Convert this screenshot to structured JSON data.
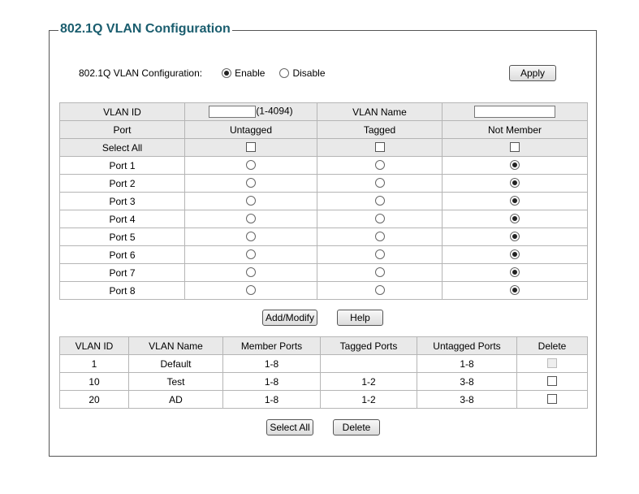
{
  "panel": {
    "title": "802.1Q VLAN Configuration"
  },
  "enable_section": {
    "label": "802.1Q VLAN Configuration:",
    "enable_label": "Enable",
    "disable_label": "Disable",
    "selected": "Enable",
    "apply_label": "Apply"
  },
  "config": {
    "vlan_id_label": "VLAN ID",
    "vlan_id_value": "",
    "vlan_id_range": "(1-4094)",
    "vlan_name_label": "VLAN Name",
    "vlan_name_value": "",
    "headers": {
      "port": "Port",
      "untagged": "Untagged",
      "tagged": "Tagged",
      "not_member": "Not Member"
    },
    "select_all_label": "Select All",
    "ports": [
      {
        "name": "Port 1",
        "mode": "Not Member"
      },
      {
        "name": "Port 2",
        "mode": "Not Member"
      },
      {
        "name": "Port 3",
        "mode": "Not Member"
      },
      {
        "name": "Port 4",
        "mode": "Not Member"
      },
      {
        "name": "Port 5",
        "mode": "Not Member"
      },
      {
        "name": "Port 6",
        "mode": "Not Member"
      },
      {
        "name": "Port 7",
        "mode": "Not Member"
      },
      {
        "name": "Port 8",
        "mode": "Not Member"
      }
    ],
    "add_modify_label": "Add/Modify",
    "help_label": "Help"
  },
  "vlan_table": {
    "headers": [
      "VLAN ID",
      "VLAN Name",
      "Member Ports",
      "Tagged Ports",
      "Untagged Ports",
      "Delete"
    ],
    "rows": [
      {
        "id": "1",
        "name": "Default",
        "member": "1-8",
        "tagged": "",
        "untagged": "1-8",
        "deletable": false
      },
      {
        "id": "10",
        "name": "Test",
        "member": "1-8",
        "tagged": "1-2",
        "untagged": "3-8",
        "deletable": true
      },
      {
        "id": "20",
        "name": "AD",
        "member": "1-8",
        "tagged": "1-2",
        "untagged": "3-8",
        "deletable": true
      }
    ],
    "select_all_label": "Select All",
    "delete_label": "Delete"
  }
}
